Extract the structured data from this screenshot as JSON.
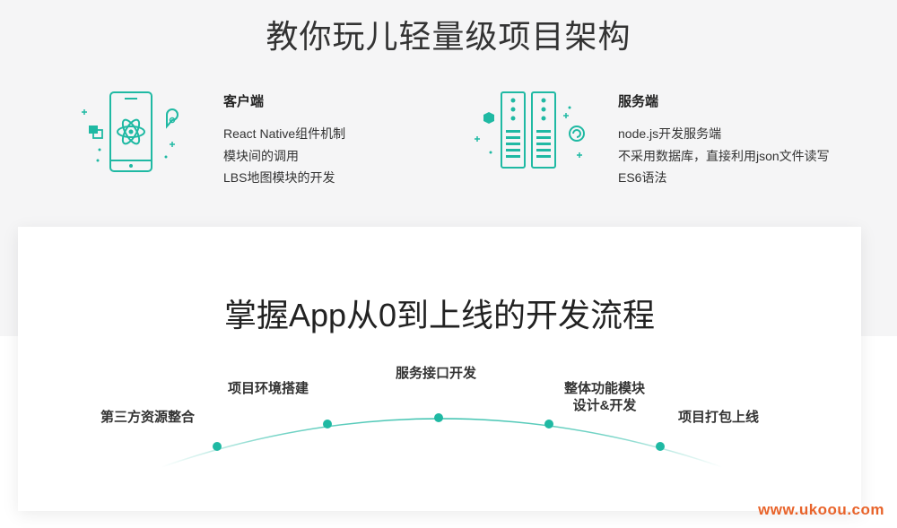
{
  "header": {
    "title": "教你玩儿轻量级项目架构"
  },
  "features": {
    "client": {
      "title": "客户端",
      "lines": [
        "React Native组件机制",
        "模块间的调用",
        "LBS地图模块的开发"
      ],
      "icon": "phone-react-icon"
    },
    "server": {
      "title": "服务端",
      "lines": [
        "node.js开发服务端",
        "不采用数据库，直接利用json文件读写",
        "ES6语法"
      ],
      "icon": "server-rack-icon"
    }
  },
  "process": {
    "title": "掌握App从0到上线的开发流程",
    "steps": [
      "第三方资源整合",
      "项目环境搭建",
      "服务接口开发",
      "整体功能模块",
      "设计&开发",
      "项目打包上线"
    ]
  },
  "watermark": "www.ukoou.com",
  "colors": {
    "accent": "#1fb9a3",
    "watermark": "#e8632a"
  }
}
